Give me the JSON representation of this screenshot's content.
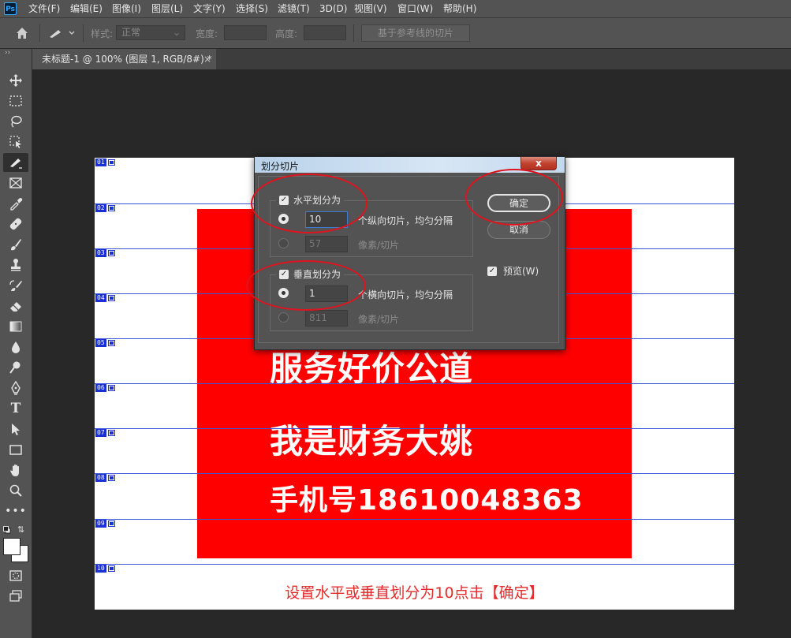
{
  "app": {
    "logo": "Ps"
  },
  "menu": [
    "文件(F)",
    "编辑(E)",
    "图像(I)",
    "图层(L)",
    "文字(Y)",
    "选择(S)",
    "滤镜(T)",
    "3D(D)",
    "视图(V)",
    "窗口(W)",
    "帮助(H)"
  ],
  "options": {
    "style_label": "样式:",
    "style_value": "正常",
    "width_label": "宽度:",
    "height_label": "高度:",
    "guides_button": "基于参考线的切片"
  },
  "tab": {
    "title": "未标题-1 @ 100% (图层 1, RGB/8#) *",
    "close": "×"
  },
  "canvas": {
    "lines": [
      "服务好价公道",
      "我是财务大姚",
      "手机号18610048363"
    ],
    "instruction": "设置水平或垂直划分为10点击【确定】",
    "slice_numbers": [
      "01",
      "02",
      "03",
      "04",
      "05",
      "06",
      "07",
      "08",
      "09",
      "10"
    ]
  },
  "dialog": {
    "title": "划分切片",
    "close": "x",
    "horizontal": {
      "label": "水平划分为",
      "count_value": "10",
      "count_suffix": "个纵向切片，均匀分隔",
      "pixel_value": "57",
      "pixel_suffix": "像素/切片"
    },
    "vertical": {
      "label": "垂直划分为",
      "count_value": "1",
      "count_suffix": "个横向切片，均匀分隔",
      "pixel_value": "811",
      "pixel_suffix": "像素/切片"
    },
    "ok": "确定",
    "cancel": "取消",
    "preview": "预览(W)"
  },
  "colors": {
    "annotation": "#e0141e",
    "slice_line": "#3d55d8",
    "banner": "#ff0000"
  }
}
